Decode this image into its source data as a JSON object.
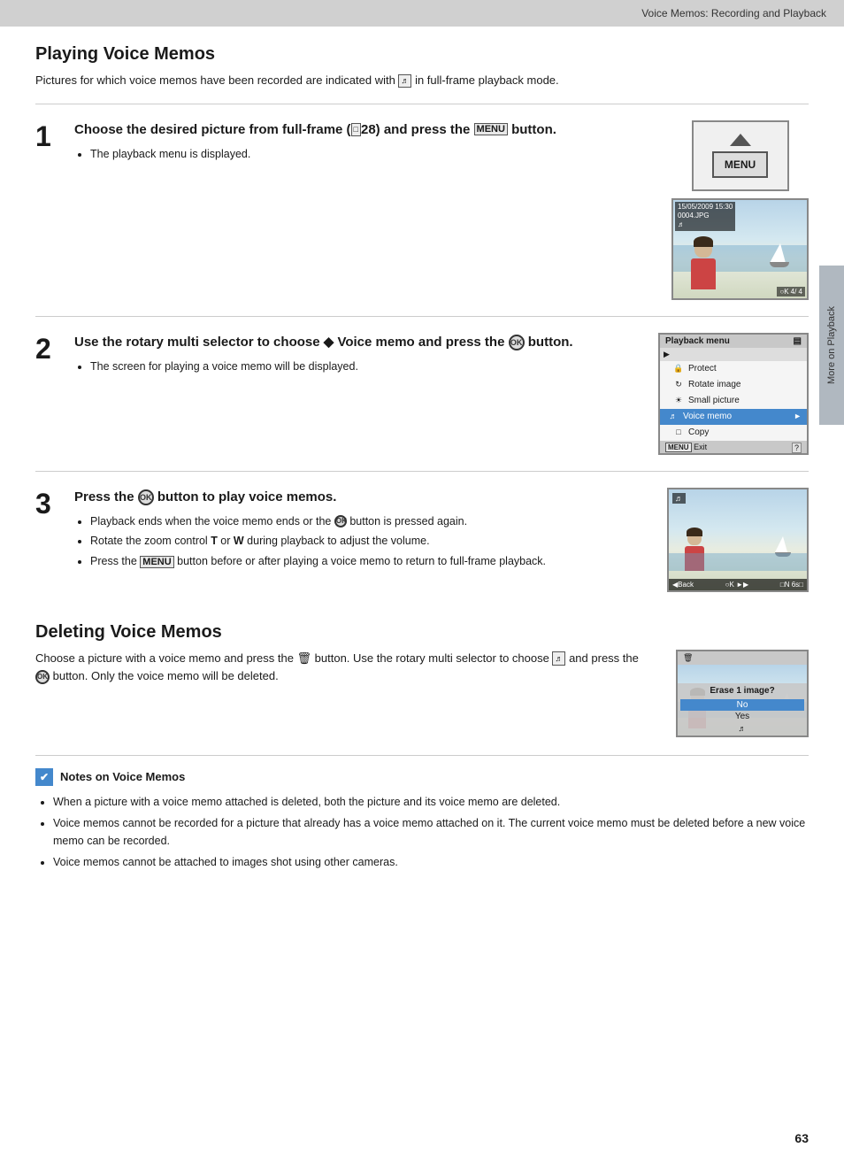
{
  "header": {
    "title": "Voice Memos: Recording and Playback"
  },
  "section1": {
    "title": "Playing Voice Memos",
    "intro": "Pictures for which voice memos have been recorded are indicated with",
    "intro2": "in full-frame playback mode.",
    "steps": [
      {
        "number": "1",
        "heading": "Choose the desired picture from full-frame (",
        "heading_ref": "□28",
        "heading_end": ") and press the MENU button.",
        "bullets": [
          "The playback menu is displayed."
        ]
      },
      {
        "number": "2",
        "heading": "Use the rotary multi selector to choose",
        "heading_bold": " Voice memo",
        "heading_end2": " and press the",
        "heading_end3": " button.",
        "bullets": [
          "The screen for playing a voice memo will be displayed."
        ]
      },
      {
        "number": "3",
        "heading": "Press the",
        "heading_end": "button to play voice memos.",
        "bullets": [
          "Playback ends when the voice memo ends or the Ⓢ button is pressed again.",
          "Rotate the zoom control T or W during playback to adjust the volume.",
          "Press the MENU button before or after playing a voice memo to return to full-frame playback."
        ]
      }
    ]
  },
  "section2": {
    "title": "Deleting Voice Memos",
    "text": "Choose a picture with a voice memo and press the 🗑 button. Use the rotary multi selector to choose",
    "text2": "and press the",
    "text3": "button. Only the voice memo will be deleted.",
    "dialog": {
      "header_icon": "🗑",
      "prompt": "Erase 1 image?",
      "option_no": "No",
      "option_yes": "Yes"
    }
  },
  "notes": {
    "title": "Notes on Voice Memos",
    "items": [
      "When a picture with a voice memo attached is deleted, both the picture and its voice memo are deleted.",
      "Voice memos cannot be recorded for a picture that already has a voice memo attached on it. The current voice memo must be deleted before a new voice memo can be recorded.",
      "Voice memos cannot be attached to images shot using other cameras."
    ]
  },
  "sidebar": {
    "label": "More on Playback"
  },
  "page": {
    "number": "63"
  },
  "playback_menu": {
    "title": "Playback menu",
    "items": [
      "Protect",
      "Rotate image",
      "Small picture",
      "Voice memo",
      "Copy"
    ],
    "footer": "Exit",
    "highlighted_index": 3
  },
  "camera_info": {
    "date": "15/05/2009 15:30",
    "filename": "0004.JPG",
    "counter": "4/",
    "total": "4"
  }
}
